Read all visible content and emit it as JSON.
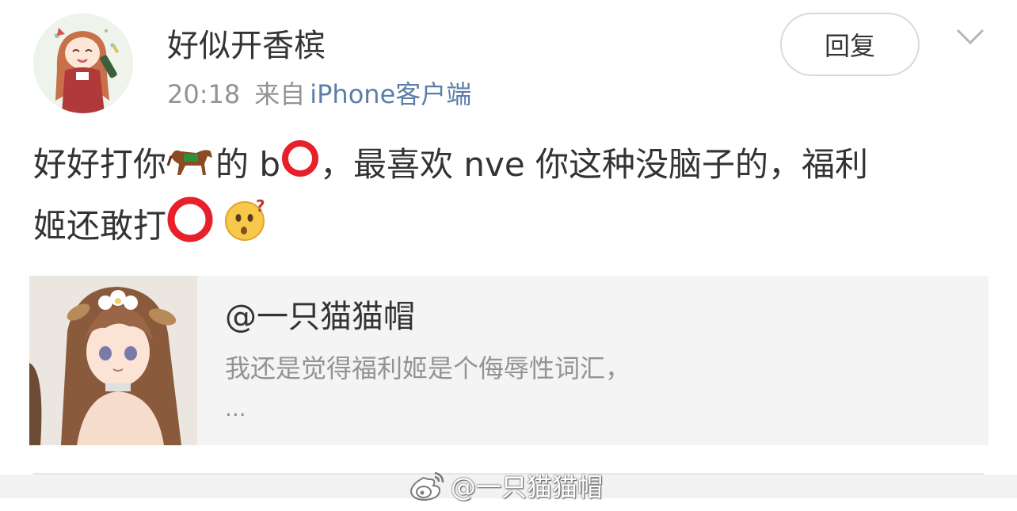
{
  "post": {
    "author": "好似开香槟",
    "time": "20:18",
    "source_prefix": "来自",
    "source_name": "iPhone客户端",
    "reply_label": "回复",
    "text_parts": {
      "a": "好好打你",
      "b": "的 b",
      "c": "，最喜欢 nve 你这种没脑子的，福利",
      "d": "姬还敢打"
    },
    "emoji": {
      "horse": "horse-emoji",
      "circle": "red-circle-emoji",
      "puzzled_face": "puzzled-face-emoji"
    }
  },
  "quote": {
    "author": "@一只猫猫帽",
    "text": "我还是觉得福利姬是个侮辱性词汇，",
    "ellipsis": "..."
  },
  "watermark": {
    "text": "@一只猫猫帽",
    "icon": "weibo-logo-icon"
  },
  "colors": {
    "link": "#5b7fa8",
    "meta_text": "#939393",
    "quote_bg": "#f4f4f4",
    "emoji_red": "#e8202a"
  }
}
